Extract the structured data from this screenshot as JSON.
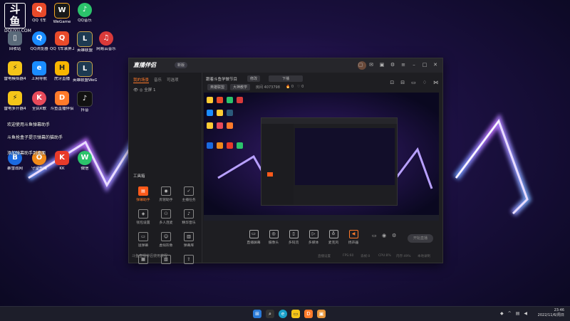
{
  "watermark": {
    "logo": "斗鱼",
    "url": "DOUYU.COM"
  },
  "desktop_icons": [
    {
      "label": "",
      "col": 0,
      "row": 0,
      "icon": "watermark-icon"
    },
    {
      "label": "QQ飞车",
      "color": "#e84a2a",
      "glyph": "Q"
    },
    {
      "label": "WeGame",
      "color": "#222",
      "glyph": "W"
    },
    {
      "label": "QQ音乐",
      "color": "#2bc36b",
      "glyph": "♪"
    },
    {
      "label": "回收站",
      "color": "#8899aa",
      "glyph": "🗑"
    },
    {
      "label": "QQ浏览器",
      "color": "#1a8cff",
      "glyph": "Q"
    },
    {
      "label": "QQ飞车录屏工具",
      "color": "#e84a2a",
      "glyph": "Q"
    },
    {
      "label": "英雄联盟",
      "color": "#2b5a7a",
      "glyph": "L"
    },
    {
      "label": "网易云音乐",
      "color": "#d93a3a",
      "glyph": "♫"
    },
    {
      "label": "雷电模拟器4",
      "color": "#f5c518",
      "glyph": "⚡"
    },
    {
      "label": "上网导航",
      "color": "#1a8cff",
      "glyph": "e"
    },
    {
      "label": "虎牙直播",
      "color": "#f7b500",
      "glyph": "H"
    },
    {
      "label": "英雄联盟WeGame版",
      "color": "#2b5a7a",
      "glyph": "L"
    },
    {
      "label": "雷电多开器4",
      "color": "#f5c518",
      "glyph": "⚡"
    },
    {
      "label": "全民K歌",
      "color": "#e84a5a",
      "glyph": "K"
    },
    {
      "label": "斗鱼直播伴侣",
      "color": "#ff7a2a",
      "glyph": "D"
    },
    {
      "label": "抖音",
      "color": "#111",
      "glyph": "♪"
    },
    {
      "label": "暴雪战网",
      "color": "#1a6ae0",
      "glyph": "B"
    },
    {
      "label": "守望先锋",
      "color": "#f08a1a",
      "glyph": "O"
    },
    {
      "label": "KK",
      "color": "#e83a2a",
      "glyph": "K"
    },
    {
      "label": "微信",
      "color": "#2bc36b",
      "glyph": "W"
    }
  ],
  "desktop_notice": {
    "line1": "欢迎使用斗鱼弹幕助手",
    "line2": "斗鱼抢盒子提示弹幕的猫助手",
    "line3": "添加弹幕助手到桌面"
  },
  "window": {
    "app_name": "直播伴侣",
    "version_badge": "新版",
    "tabs": [
      "我的场景",
      "音乐",
      "可选项"
    ],
    "scene_label": "全屏 1",
    "tool_section_title": "工具箱",
    "tools": [
      "弹幕助手",
      "房管助手",
      "主播任务",
      "钱包设置",
      "多人连麦",
      "精华音乐",
      "送弹幕",
      "虚拟形象",
      "弹幕库",
      "",
      "",
      ""
    ],
    "bottom_hint": "斗鱼直播伴侣使用教程",
    "room_title": "跟着斗鱼学做节目",
    "room_btn_edit": "修改",
    "room_btn_category": "下播",
    "room_category": "英雄联盟",
    "room_subcat": "大神教学",
    "room_no_label": "房间",
    "room_no": "4073798",
    "fans": "0",
    "likes": "0",
    "controls": [
      "直播屏幕",
      "摄像头",
      "多码流",
      "多媒体",
      "麦克风",
      "扬声器"
    ],
    "go_live": "开始直播",
    "status": [
      "直播设置",
      "FPS:60",
      "丢帧:0",
      "CPU:8%",
      "内存:49%",
      "本地录制"
    ]
  },
  "taskbar": {
    "time": "23:46",
    "date": "2022/11/6/周日",
    "apps": [
      "windows-icon",
      "search-icon",
      "edge-icon",
      "explorer-icon",
      "douyu-icon",
      "store-icon"
    ]
  }
}
